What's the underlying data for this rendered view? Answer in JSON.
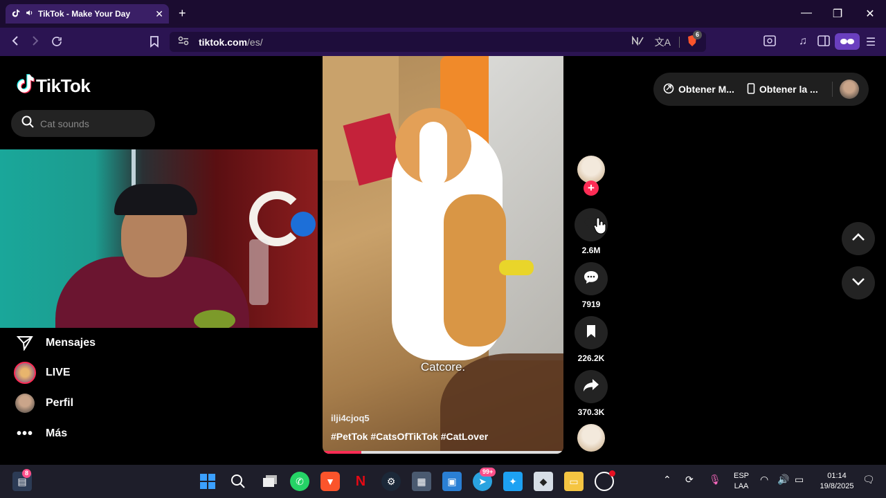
{
  "browser": {
    "tab_title": "TikTok - Make Your Day",
    "url_host": "tiktok.com",
    "url_path": "/es/",
    "extension_badge": "6"
  },
  "sidebar": {
    "logo": "TikTok",
    "search_placeholder": "Cat sounds",
    "items": [
      {
        "label": "Mensajes",
        "icon": "send-icon"
      },
      {
        "label": "LIVE",
        "icon": "live-icon"
      },
      {
        "label": "Perfil",
        "icon": "profile-avatar"
      },
      {
        "label": "Más",
        "icon": "more-icon"
      }
    ]
  },
  "video": {
    "caption": "Catcore.",
    "author": "ilji4cjoq5",
    "hashtags": "#PetTok #CatsOfTikTok #CatLover",
    "progress_fraction": 0.16
  },
  "actions": {
    "likes": "2.6M",
    "comments": "7919",
    "saves": "226.2K",
    "shares": "370.3K"
  },
  "top_right": {
    "get_app_label": "Obtener M...",
    "get_app2_label": "Obtener la ..."
  },
  "taskbar": {
    "notification_badge": "8",
    "telegram_badge": "99+",
    "language": "ESP",
    "layout": "LAA",
    "time": "01:14",
    "date": "19/8/2025"
  },
  "colors": {
    "accent": "#fe2c55",
    "browser_chrome": "#2b1452",
    "tab_active": "#3a1f66"
  }
}
